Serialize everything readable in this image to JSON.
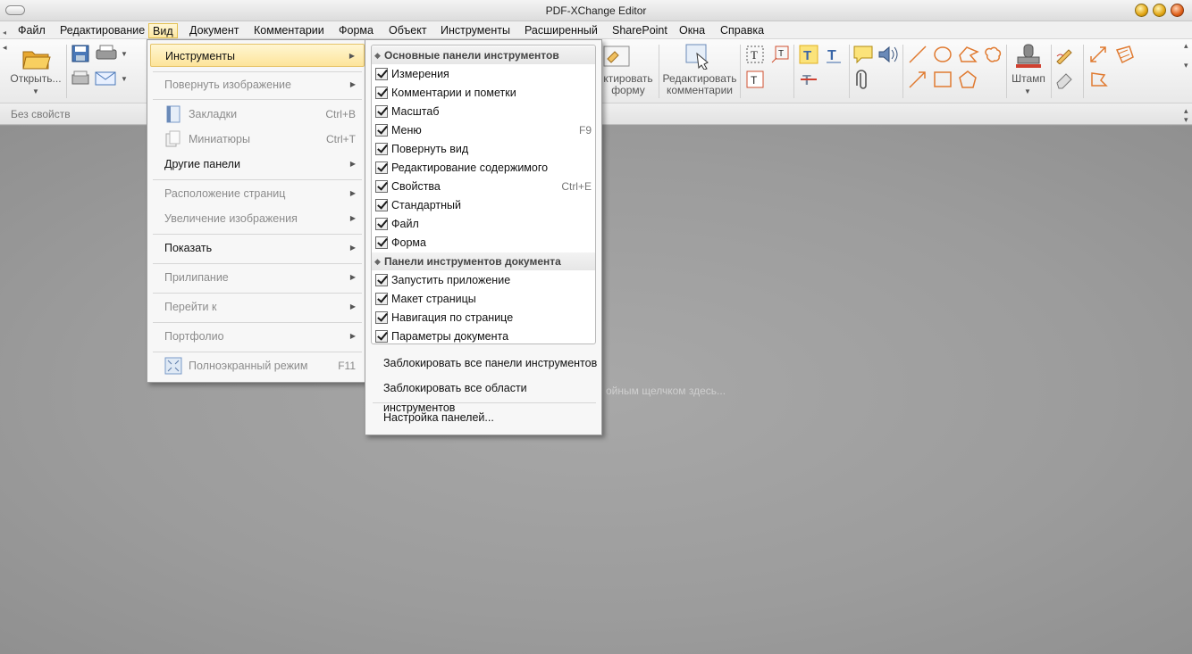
{
  "window": {
    "title": "PDF-XChange Editor"
  },
  "menubar": {
    "items": [
      "Файл",
      "Редактирование",
      "Вид",
      "Документ",
      "Комментарии",
      "Форма",
      "Объект",
      "Инструменты",
      "Расширенный",
      "SharePoint",
      "Окна",
      "Справка"
    ]
  },
  "ribbon": {
    "open_label": "Открыть...",
    "edit_form_label_1": "ктировать",
    "edit_form_label_2": "форму",
    "edit_comments_label_1": "Редактировать",
    "edit_comments_label_2": "комментарии",
    "stamp_label": "Штамп"
  },
  "propbar": {
    "label": "Без свойств"
  },
  "workspace": {
    "hint": "ойным щелчком здесь..."
  },
  "view_menu": {
    "items": [
      {
        "label": "Инструменты",
        "arrow": "▶",
        "state": "highlighted"
      },
      {
        "label": "Повернуть изображение",
        "arrow": "▶",
        "state": "disabled"
      },
      {
        "label": "Закладки",
        "shortcut": "Ctrl+B",
        "state": "disabled",
        "icon": "bookmarks-icon"
      },
      {
        "label": "Миниатюры",
        "shortcut": "Ctrl+T",
        "state": "disabled",
        "icon": "thumbnails-icon"
      },
      {
        "label": "Другие панели",
        "arrow": "▶",
        "state": "normal"
      },
      {
        "label": "Расположение страниц",
        "arrow": "▶",
        "state": "disabled"
      },
      {
        "label": "Увеличение изображения",
        "arrow": "▶",
        "state": "disabled"
      },
      {
        "label": "Показать",
        "arrow": "▶",
        "state": "normal"
      },
      {
        "label": "Прилипание",
        "arrow": "▶",
        "state": "disabled"
      },
      {
        "label": "Перейти к",
        "arrow": "▶",
        "state": "disabled"
      },
      {
        "label": "Портфолио",
        "arrow": "▶",
        "state": "disabled"
      },
      {
        "label": "Полноэкранный режим",
        "shortcut": "F11",
        "state": "disabled",
        "icon": "fullscreen-icon"
      }
    ]
  },
  "toolbars_menu": {
    "group1_title": "Основные панели инструментов",
    "group1": [
      {
        "label": "Измерения",
        "checked": true
      },
      {
        "label": "Комментарии и пометки",
        "checked": true
      },
      {
        "label": "Масштаб",
        "checked": true
      },
      {
        "label": "Меню",
        "shortcut": "F9",
        "checked": true
      },
      {
        "label": "Повернуть вид",
        "checked": true
      },
      {
        "label": "Редактирование содержимого",
        "checked": true
      },
      {
        "label": "Свойства",
        "shortcut": "Ctrl+E",
        "checked": true
      },
      {
        "label": "Стандартный",
        "checked": true
      },
      {
        "label": "Файл",
        "checked": true
      },
      {
        "label": "Форма",
        "checked": true
      }
    ],
    "group2_title": "Панели инструментов документа",
    "group2": [
      {
        "label": "Запустить приложение",
        "checked": true
      },
      {
        "label": "Макет страницы",
        "checked": true
      },
      {
        "label": "Навигация по странице",
        "checked": true
      },
      {
        "label": "Параметры документа",
        "checked": true
      }
    ],
    "lock_toolbars": "Заблокировать все панели инструментов",
    "lock_areas": "Заблокировать все области инструментов",
    "customize": "Настройка панелей..."
  },
  "colors": {
    "highlight": "#fde49a",
    "orange_tool": "#e07a30"
  }
}
